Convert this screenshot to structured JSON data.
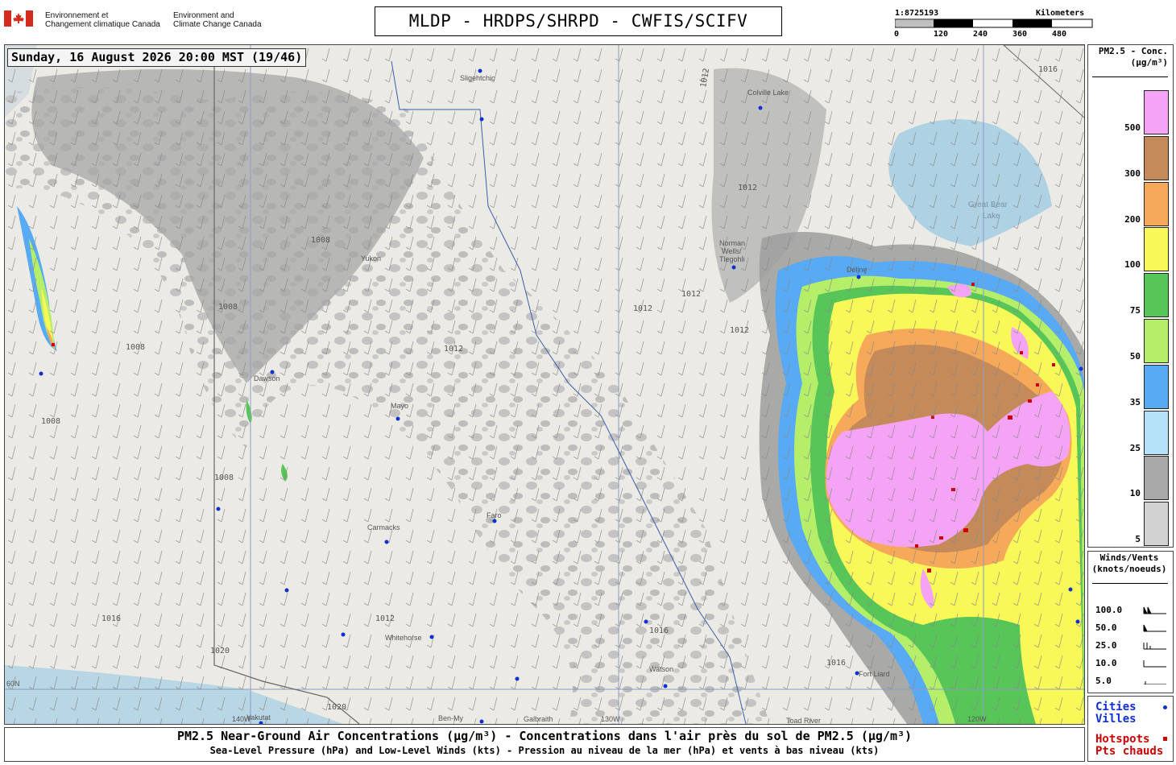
{
  "header": {
    "agency_fr": [
      "Environnement et",
      "Changement climatique Canada"
    ],
    "agency_en": [
      "Environment and",
      "Climate Change Canada"
    ],
    "title": "MLDP - HRDPS/SHRPD - CWFIS/SCIFV"
  },
  "scale": {
    "ratio": "1:8725193",
    "unit": "Kilometers",
    "ticks": [
      "0",
      "120",
      "240",
      "360",
      "480"
    ]
  },
  "timestamp": "Sunday, 16 August 2026 20:00 MST (19/46)",
  "legend": {
    "title_line1": "PM2.5 - Conc.",
    "title_line2": "(µg/m³)",
    "classes": [
      {
        "label": "500",
        "color": "#f5a3f5"
      },
      {
        "label": "300",
        "color": "#c48a5a"
      },
      {
        "label": "200",
        "color": "#f7a95a"
      },
      {
        "label": "100",
        "color": "#f8f858"
      },
      {
        "label": "75",
        "color": "#58c558"
      },
      {
        "label": "50",
        "color": "#b5ef6a"
      },
      {
        "label": "35",
        "color": "#58aaf5"
      },
      {
        "label": "25",
        "color": "#b5e2f8"
      },
      {
        "label": "10",
        "color": "#a8a8a8"
      },
      {
        "label": "5",
        "color": "#d2d2d2"
      }
    ]
  },
  "winds": {
    "title_line1": "Winds/Vents",
    "title_line2": "(knots/noeuds)",
    "values": [
      "100.0",
      "50.0",
      "25.0",
      "10.0",
      "5.0"
    ]
  },
  "key": {
    "cities_en": "Cities",
    "cities_fr": "Villes",
    "hotspots_en": "Hotspots",
    "hotspots_fr": "Pts chauds",
    "city_color": "#1030d0",
    "hotspot_color": "#cc0000"
  },
  "footer": {
    "line1": "PM2.5 Near-Ground Air Concentrations (µg/m³) - Concentrations dans l'air près du sol de PM2.5 (µg/m³)",
    "line2": "Sea-Level Pressure (hPa) and Low-Level Winds (kts) - Pression au niveau de la mer (hPa) et vents à bas niveau (kts)"
  },
  "map": {
    "places": [
      {
        "name": "Sligehtchic"
      },
      {
        "name": "Colville Lake"
      },
      {
        "name": "Great Bear"
      },
      {
        "name": "Lake"
      },
      {
        "name": "Norman"
      },
      {
        "name": "Wells/"
      },
      {
        "name": "Tlegohli"
      },
      {
        "name": "Délįnę"
      },
      {
        "name": "Dawson"
      },
      {
        "name": "Mayo"
      },
      {
        "name": "Faro"
      },
      {
        "name": "Carmacks"
      },
      {
        "name": "Whitehorse"
      },
      {
        "name": "Watson"
      },
      {
        "name": "Fort Liard"
      },
      {
        "name": "Yakutat"
      },
      {
        "name": "Ben-My"
      },
      {
        "name": "Galbraith"
      },
      {
        "name": "Toad River"
      },
      {
        "name": "Yukon"
      }
    ],
    "isobars": [
      "1016",
      "1012",
      "1008",
      "1020"
    ],
    "graticule": [
      "60N",
      "140W",
      "130W",
      "120W"
    ]
  }
}
